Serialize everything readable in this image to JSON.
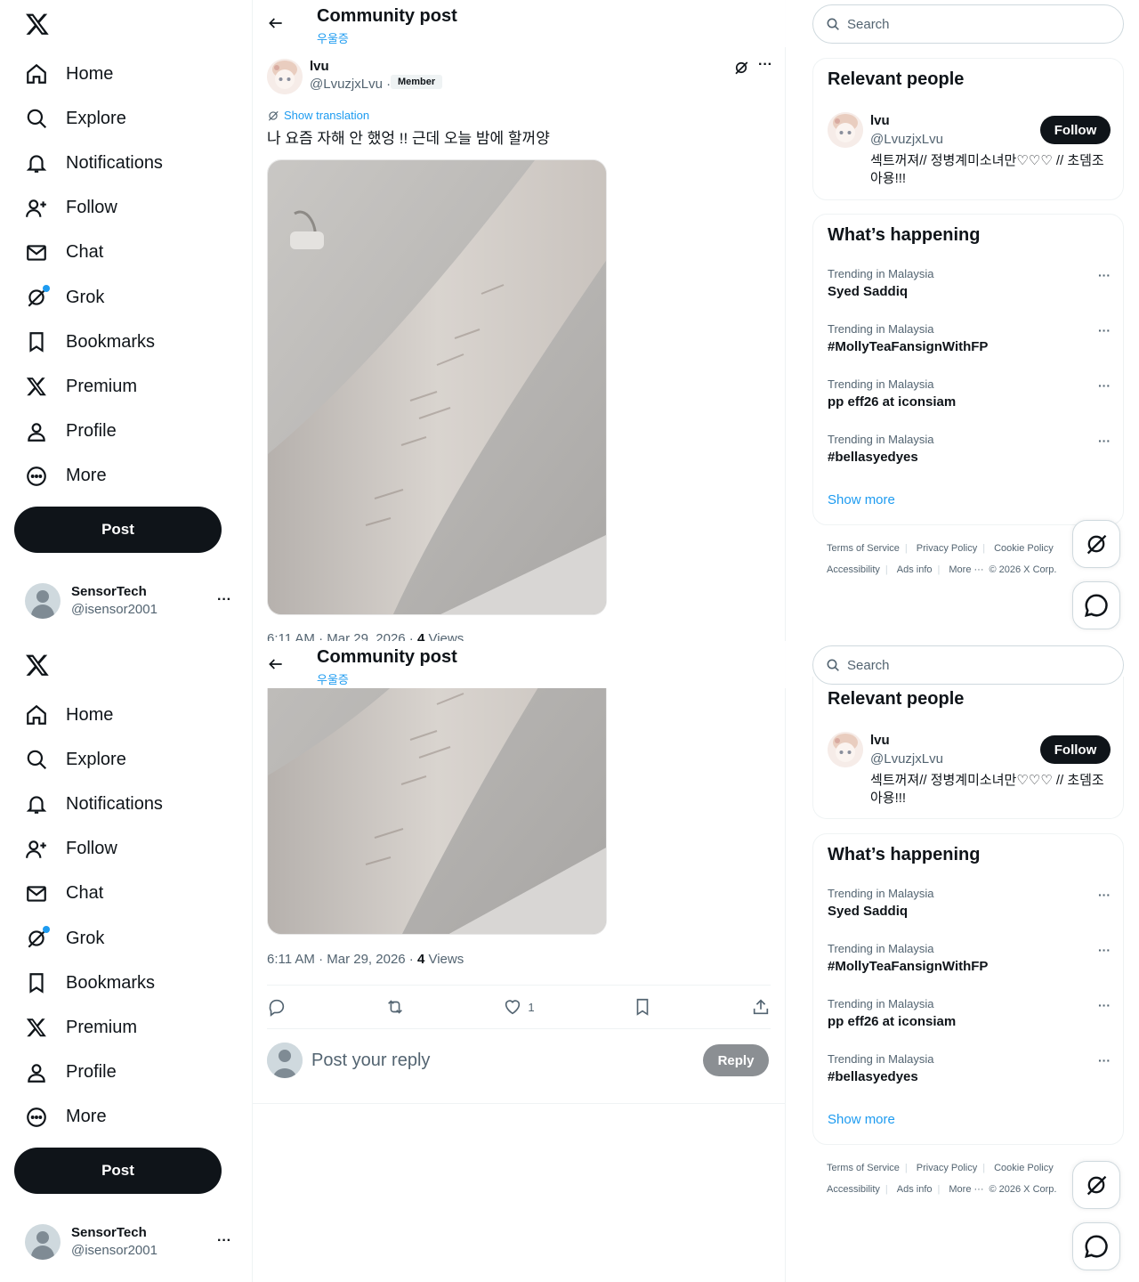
{
  "nav": {
    "items": [
      {
        "label": "Home",
        "icon": "home-icon"
      },
      {
        "label": "Explore",
        "icon": "search-icon"
      },
      {
        "label": "Notifications",
        "icon": "bell-icon"
      },
      {
        "label": "Follow",
        "icon": "person-plus-icon"
      },
      {
        "label": "Chat",
        "icon": "mail-icon"
      },
      {
        "label": "Grok",
        "icon": "grok-icon"
      },
      {
        "label": "Bookmarks",
        "icon": "bookmark-icon"
      },
      {
        "label": "Premium",
        "icon": "x-logo-icon"
      },
      {
        "label": "Profile",
        "icon": "person-icon"
      },
      {
        "label": "More",
        "icon": "more-circle-icon"
      }
    ],
    "post_label": "Post",
    "account": {
      "name": "SensorTech",
      "handle": "@isensor2001",
      "more": "···"
    }
  },
  "header": {
    "title": "Community post",
    "community": "우울증"
  },
  "post": {
    "author_name": "lvu",
    "author_handle": "@LvuzjxLvu ·",
    "badge": "Member",
    "more": "···",
    "translate_label": "Show translation",
    "text": "나 요즘 자해 안 했엉 !! 근데 오늘 밤에 할꺼양",
    "time": "6:11 AM · Mar 29, 2026 · ",
    "views_count": "4",
    "views_label": " Views",
    "likes": "1"
  },
  "reply": {
    "placeholder": "Post your reply",
    "button": "Reply"
  },
  "sidebar": {
    "search_placeholder": "Search",
    "relevant": {
      "title": "Relevant people",
      "name": "lvu",
      "handle": "@LvuzjxLvu",
      "bio": "섹트꺼져// 정병계미소녀만♡♡♡ // 초뎀조아용!!!",
      "follow_label": "Follow"
    },
    "happening": {
      "title": "What’s happening",
      "trends": [
        {
          "context": "Trending in Malaysia",
          "title": "Syed Saddiq"
        },
        {
          "context": "Trending in Malaysia",
          "title": "#MollyTeaFansignWithFP"
        },
        {
          "context": "Trending in Malaysia",
          "title": "pp eff26 at iconsiam"
        },
        {
          "context": "Trending in Malaysia",
          "title": "#bellasyedyes"
        }
      ],
      "show_more": "Show more",
      "trend_more": "···"
    },
    "footer": {
      "terms": "Terms of Service",
      "privacy": "Privacy Policy",
      "cookie": "Cookie Policy",
      "accessibility": "Accessibility",
      "ads": "Ads info",
      "more": "More ···",
      "copyright": "© 2026 X Corp."
    }
  },
  "colors": {
    "accent": "#1d9bf0",
    "text": "#0f1419",
    "muted": "#536471",
    "button_dark": "#0f1419"
  }
}
